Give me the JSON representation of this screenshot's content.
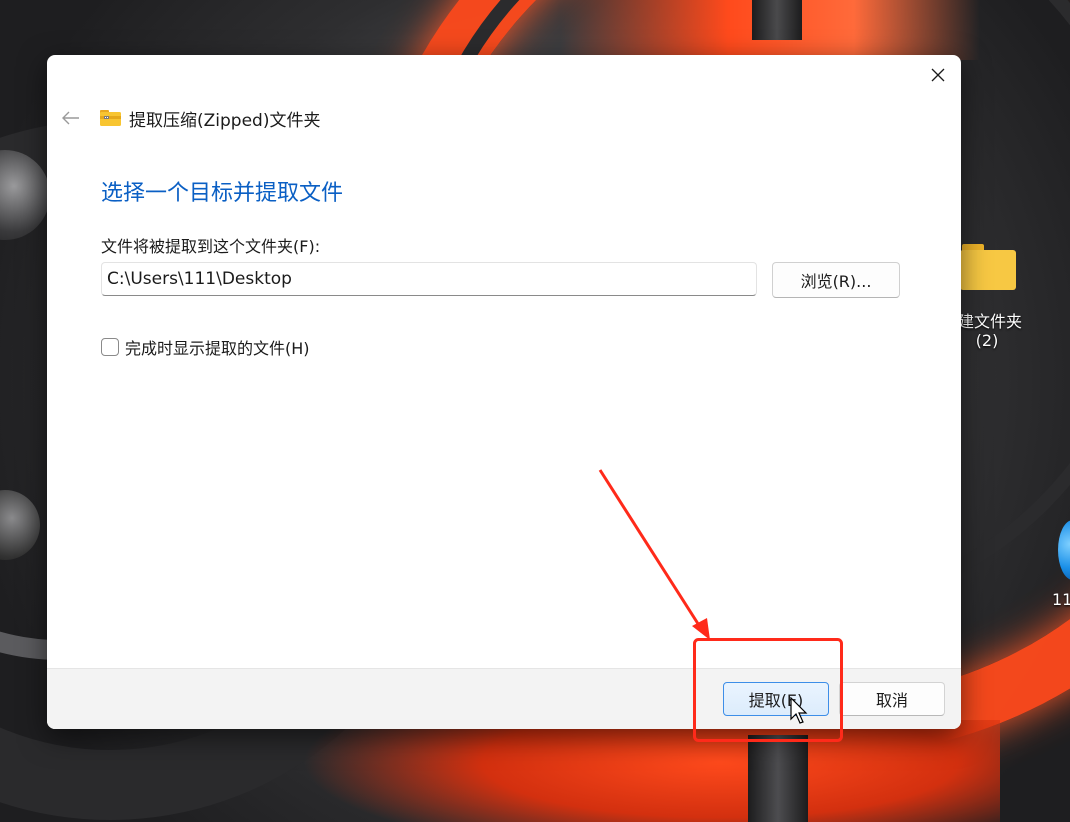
{
  "dialog": {
    "title": "提取压缩(Zipped)文件夹",
    "heading": "选择一个目标并提取文件",
    "destination_label": "文件将被提取到这个文件夹(F):",
    "destination_value": "C:\\Users\\111\\Desktop",
    "browse_label": "浏览(R)...",
    "show_files_label": "完成时显示提取的文件(H)",
    "show_files_checked": false,
    "extract_label": "提取(E)",
    "cancel_label": "取消"
  },
  "desktop": {
    "folder_label_line1": "建文件夹",
    "folder_label_line2": "(2)",
    "partial_label": "11"
  },
  "icons": {
    "back": "arrow-left-icon",
    "close": "close-icon",
    "zip_folder": "zip-folder-icon",
    "cursor": "mouse-pointer-icon"
  },
  "colors": {
    "heading": "#0a5fc4",
    "annotation": "#ff2a1a",
    "primary_button_border": "#3d8ee8"
  }
}
